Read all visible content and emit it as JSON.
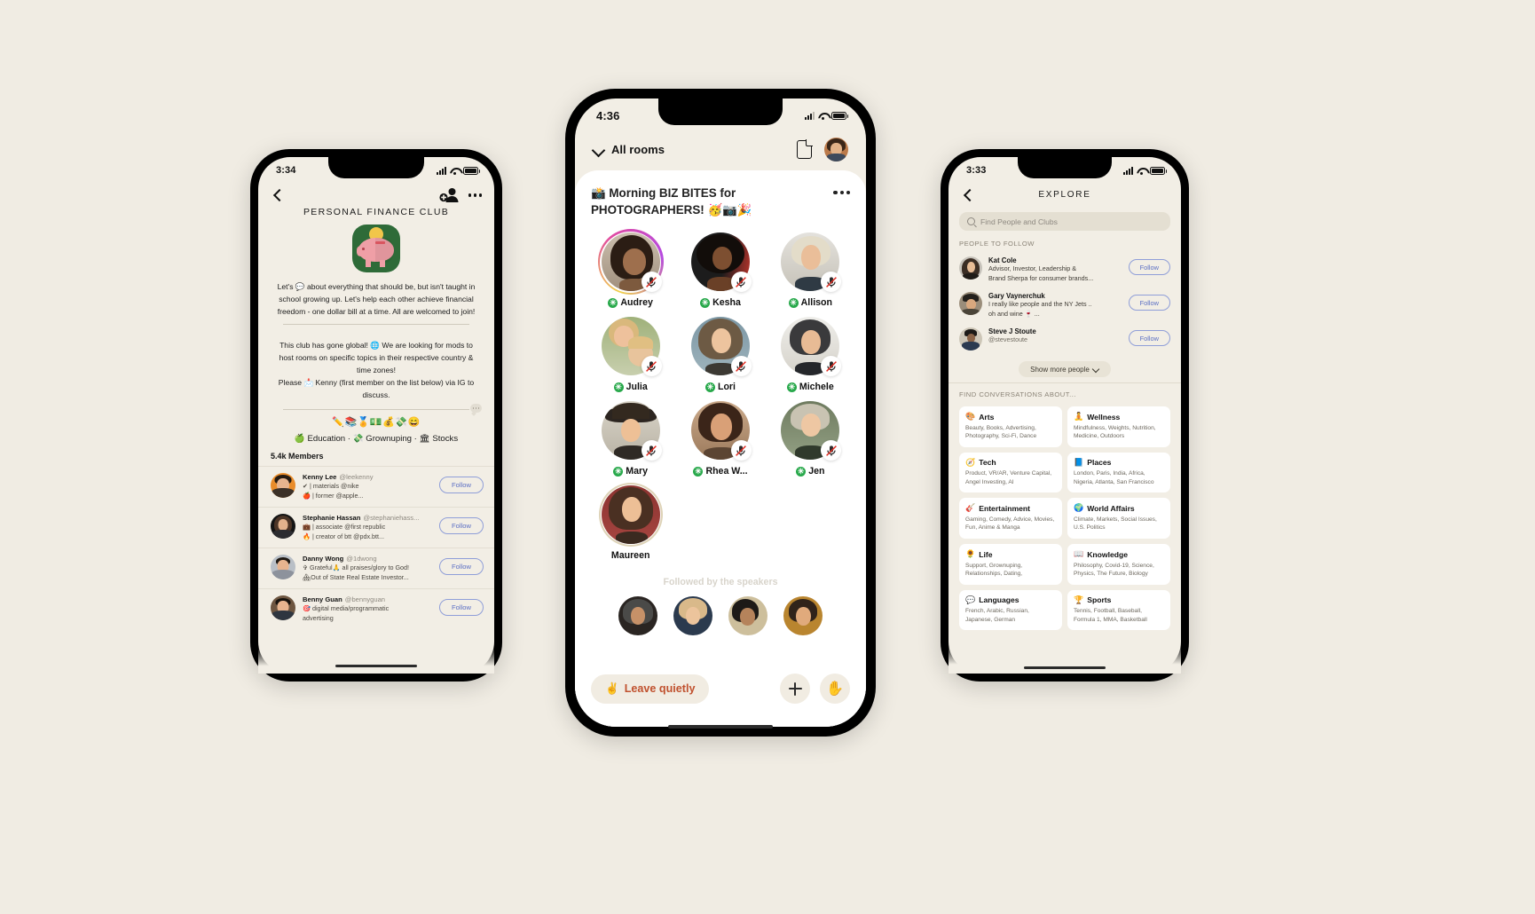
{
  "canvas": {
    "background": "#f0ece3"
  },
  "phone1": {
    "status": {
      "time": "3:34"
    },
    "nav": {
      "back_icon": "chevron-left-icon",
      "add_member_icon": "add-person-icon",
      "more_icon": "more-dots-icon"
    },
    "club": {
      "title": "PERSONAL FINANCE CLUB",
      "logo_icon": "piggy-bank-icon",
      "description": "Let's 💬 about everything that should be, but isn't taught in school growing up. Let's help each other achieve financial freedom - one dollar bill at a time. All are welcomed to join!",
      "description2": "This club has gone global! 🌐 We are looking for mods to host rooms on specific topics in their respective country & time zones!\nPlease 📩 Kenny (first member on the list below) via IG to discuss.",
      "emoji_row": "✏️📚🏅💵💰💸😄",
      "tags": "🍏 Education · 💸 Grownuping · 🏛 Stocks",
      "members_count": "5.4k Members"
    },
    "members": [
      {
        "name": "Kenny Lee",
        "handle": "@leekenny",
        "bio1": "✔ | materials @nike",
        "bio2": "🍎 | former @apple...",
        "follow_label": "Follow"
      },
      {
        "name": "Stephanie Hassan",
        "handle": "@stephaniehass...",
        "bio1": "💼 | associate @first republic",
        "bio2": "🔥 | creator of btt @pdx.btt...",
        "follow_label": "Follow"
      },
      {
        "name": "Danny Wong",
        "handle": "@1dwong",
        "bio1": "✞ Grateful🙏 all praises/glory to God!",
        "bio2": "🏘Out of State Real Estate Investor...",
        "follow_label": "Follow"
      },
      {
        "name": "Benny Guan",
        "handle": "@bennyguan",
        "bio1": "🎯 digital media/programmatic",
        "bio2": "advertising",
        "follow_label": "Follow"
      }
    ]
  },
  "phone2": {
    "status": {
      "time": "4:36"
    },
    "nav": {
      "all_rooms_label": "All rooms",
      "chevron_icon": "chevron-down-icon",
      "doc_icon": "document-icon",
      "avatar_icon": "user-avatar"
    },
    "room": {
      "title": "📸 Morning BIZ BITES for PHOTOGRAPHERS! 🥳📷🎉",
      "more_icon": "more-dots-icon"
    },
    "speakers": [
      {
        "name": "Audrey",
        "muted": true,
        "speaking_ring": true,
        "badge": "green-star"
      },
      {
        "name": "Kesha",
        "muted": true,
        "speaking_ring": false,
        "badge": "green-star"
      },
      {
        "name": "Allison",
        "muted": true,
        "speaking_ring": false,
        "badge": "green-star"
      },
      {
        "name": "Julia",
        "muted": true,
        "speaking_ring": false,
        "badge": "green-star"
      },
      {
        "name": "Lori",
        "muted": true,
        "speaking_ring": false,
        "badge": "green-star"
      },
      {
        "name": "Michele",
        "muted": true,
        "speaking_ring": false,
        "badge": "green-star"
      },
      {
        "name": "Mary",
        "muted": true,
        "speaking_ring": false,
        "badge": "green-star"
      },
      {
        "name": "Rhea W...",
        "muted": true,
        "speaking_ring": false,
        "badge": "green-star"
      },
      {
        "name": "Jen",
        "muted": true,
        "speaking_ring": false,
        "badge": "green-star"
      },
      {
        "name": "Maureen",
        "muted": false,
        "speaking_ring": false,
        "badge": "none"
      }
    ],
    "followed_label": "Followed by the speakers",
    "bottom": {
      "leave_label": "Leave quietly",
      "leave_emoji": "✌️",
      "add_icon": "plus-icon",
      "hand_icon": "raise-hand-icon",
      "hand_emoji": "✋"
    }
  },
  "phone3": {
    "status": {
      "time": "3:33"
    },
    "nav": {
      "back_icon": "chevron-left-icon",
      "title": "EXPLORE"
    },
    "search": {
      "placeholder": "Find People and Clubs",
      "icon": "search-icon"
    },
    "people_section_title": "PEOPLE TO FOLLOW",
    "people": [
      {
        "name": "Kat Cole",
        "bio1": "Advisor, Investor, Leadership &",
        "bio2": "Brand Sherpa for consumer brands...",
        "follow_label": "Follow"
      },
      {
        "name": "Gary Vaynerchuk",
        "bio1": "I really like people and the NY Jets ..",
        "bio2": "oh and wine 🍷 ...",
        "follow_label": "Follow"
      },
      {
        "name": "Steve J Stoute",
        "bio1": "@stevestoute",
        "bio2": "",
        "follow_label": "Follow"
      }
    ],
    "show_more_label": "Show more people",
    "show_more_icon": "chevron-down-icon",
    "categories_title": "FIND CONVERSATIONS ABOUT...",
    "categories": [
      {
        "emoji": "🎨",
        "name": "Arts",
        "desc": "Beauty, Books, Advertising, Photography, Sci-Fi, Dance"
      },
      {
        "emoji": "🧘",
        "name": "Wellness",
        "desc": "Mindfulness, Weights, Nutrition, Medicine, Outdoors"
      },
      {
        "emoji": "🧭",
        "name": "Tech",
        "desc": "Product, VR/AR, Venture Capital, Angel Investing, AI"
      },
      {
        "emoji": "📘",
        "name": "Places",
        "desc": "London, Paris, India, Africa, Nigeria, Atlanta, San Francisco"
      },
      {
        "emoji": "🎸",
        "name": "Entertainment",
        "desc": "Gaming, Comedy, Advice, Movies, Fun, Anime & Manga"
      },
      {
        "emoji": "🌍",
        "name": "World Affairs",
        "desc": "Climate, Markets, Social Issues, U.S. Politics"
      },
      {
        "emoji": "🌻",
        "name": "Life",
        "desc": "Support, Grownuping, Relationships, Dating,"
      },
      {
        "emoji": "📖",
        "name": "Knowledge",
        "desc": "Philosophy, Covid-19, Science, Physics, The Future, Biology"
      },
      {
        "emoji": "💬",
        "name": "Languages",
        "desc": "French, Arabic, Russian, Japanese, German"
      },
      {
        "emoji": "🏆",
        "name": "Sports",
        "desc": "Tennis, Football, Baseball, Formula 1, MMA, Basketball"
      }
    ]
  }
}
